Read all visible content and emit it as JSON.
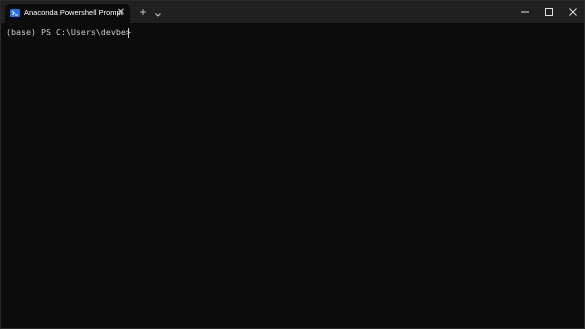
{
  "tab": {
    "title": "Anaconda Powershell Prompt",
    "icon": "powershell-icon",
    "close_glyph": "✕"
  },
  "titlebar": {
    "new_tab_glyph": "+"
  },
  "terminal": {
    "prompt": "(base) PS C:\\Users\\devbe> "
  },
  "colors": {
    "background": "#0c0c0c",
    "titlebar": "#202020",
    "text": "#cccccc",
    "icon_accent": "#1f6feb"
  }
}
